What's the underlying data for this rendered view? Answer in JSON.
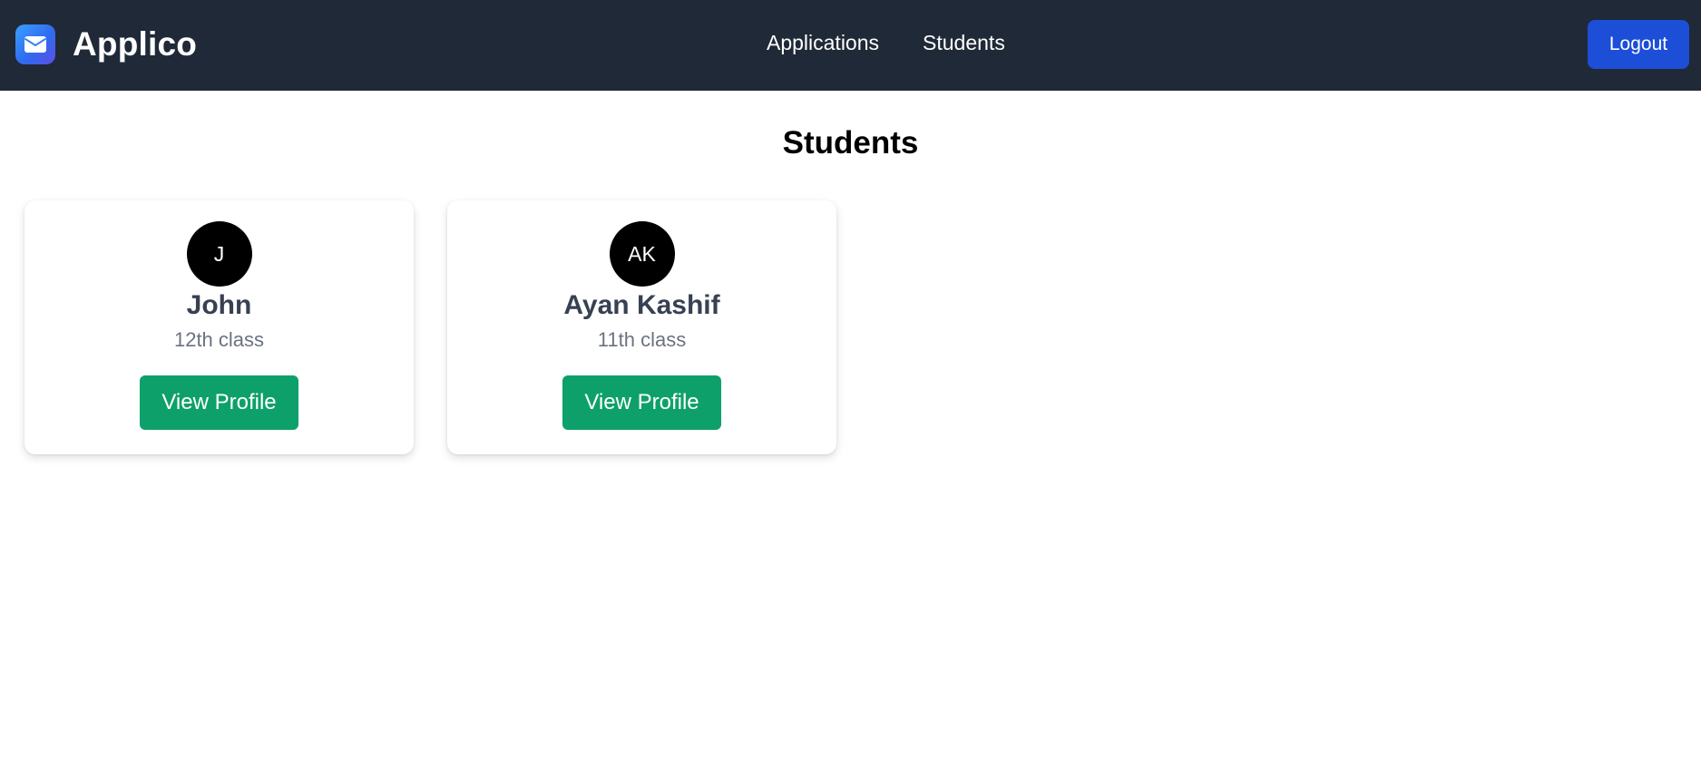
{
  "brand": {
    "name": "Applico",
    "icon": "envelope-icon"
  },
  "nav": {
    "links": [
      {
        "label": "Applications"
      },
      {
        "label": "Students"
      }
    ],
    "logout_label": "Logout"
  },
  "page": {
    "title": "Students"
  },
  "students": [
    {
      "initials": "J",
      "name": "John",
      "class": "12th class",
      "button_label": "View Profile"
    },
    {
      "initials": "AK",
      "name": "Ayan Kashif",
      "class": "11th class",
      "button_label": "View Profile"
    }
  ],
  "colors": {
    "navbar_bg": "#1f2937",
    "logout_bg": "#1d4ed8",
    "view_profile_bg": "#0ea06b",
    "avatar_bg": "#000000"
  }
}
